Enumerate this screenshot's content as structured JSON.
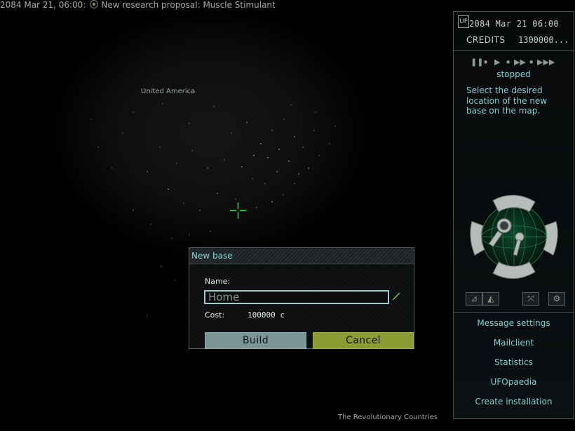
{
  "news": {
    "timestamp": "2084 Mar 21, 06:00:",
    "message": "New research proposal: Muscle Stimulant",
    "icon": "research-icon"
  },
  "map": {
    "region_label": "United America",
    "bottom_label": "The Revolutionary Countries"
  },
  "panel": {
    "logo_text": "UF",
    "datetime": "2084 Mar 21 06:00",
    "credits_label": "CREDITS",
    "credits_value": "1300000...",
    "time_status": "stopped",
    "instruction": "Select the desired location of the new base on the map.",
    "time_controls": [
      "pause-icon",
      "play-icon",
      "fast-forward-icon",
      "fastest-icon"
    ],
    "globe_tools": [
      "aircraft-icon",
      "base-map-icon",
      "fullscreen-icon",
      "settings-icon"
    ],
    "menu": [
      "Message settings",
      "Mailclient",
      "Statistics",
      "UFOpaedia",
      "Create installation"
    ]
  },
  "dialog": {
    "title": "New base",
    "name_label": "Name:",
    "name_value": "Home",
    "cost_label": "Cost:",
    "cost_value": "100000 c",
    "build_label": "Build",
    "cancel_label": "Cancel"
  },
  "colors": {
    "accent_cyan": "#85cfd6",
    "build_button": "#7b9597",
    "cancel_button": "#8b9a33",
    "crosshair": "#22d64a"
  }
}
